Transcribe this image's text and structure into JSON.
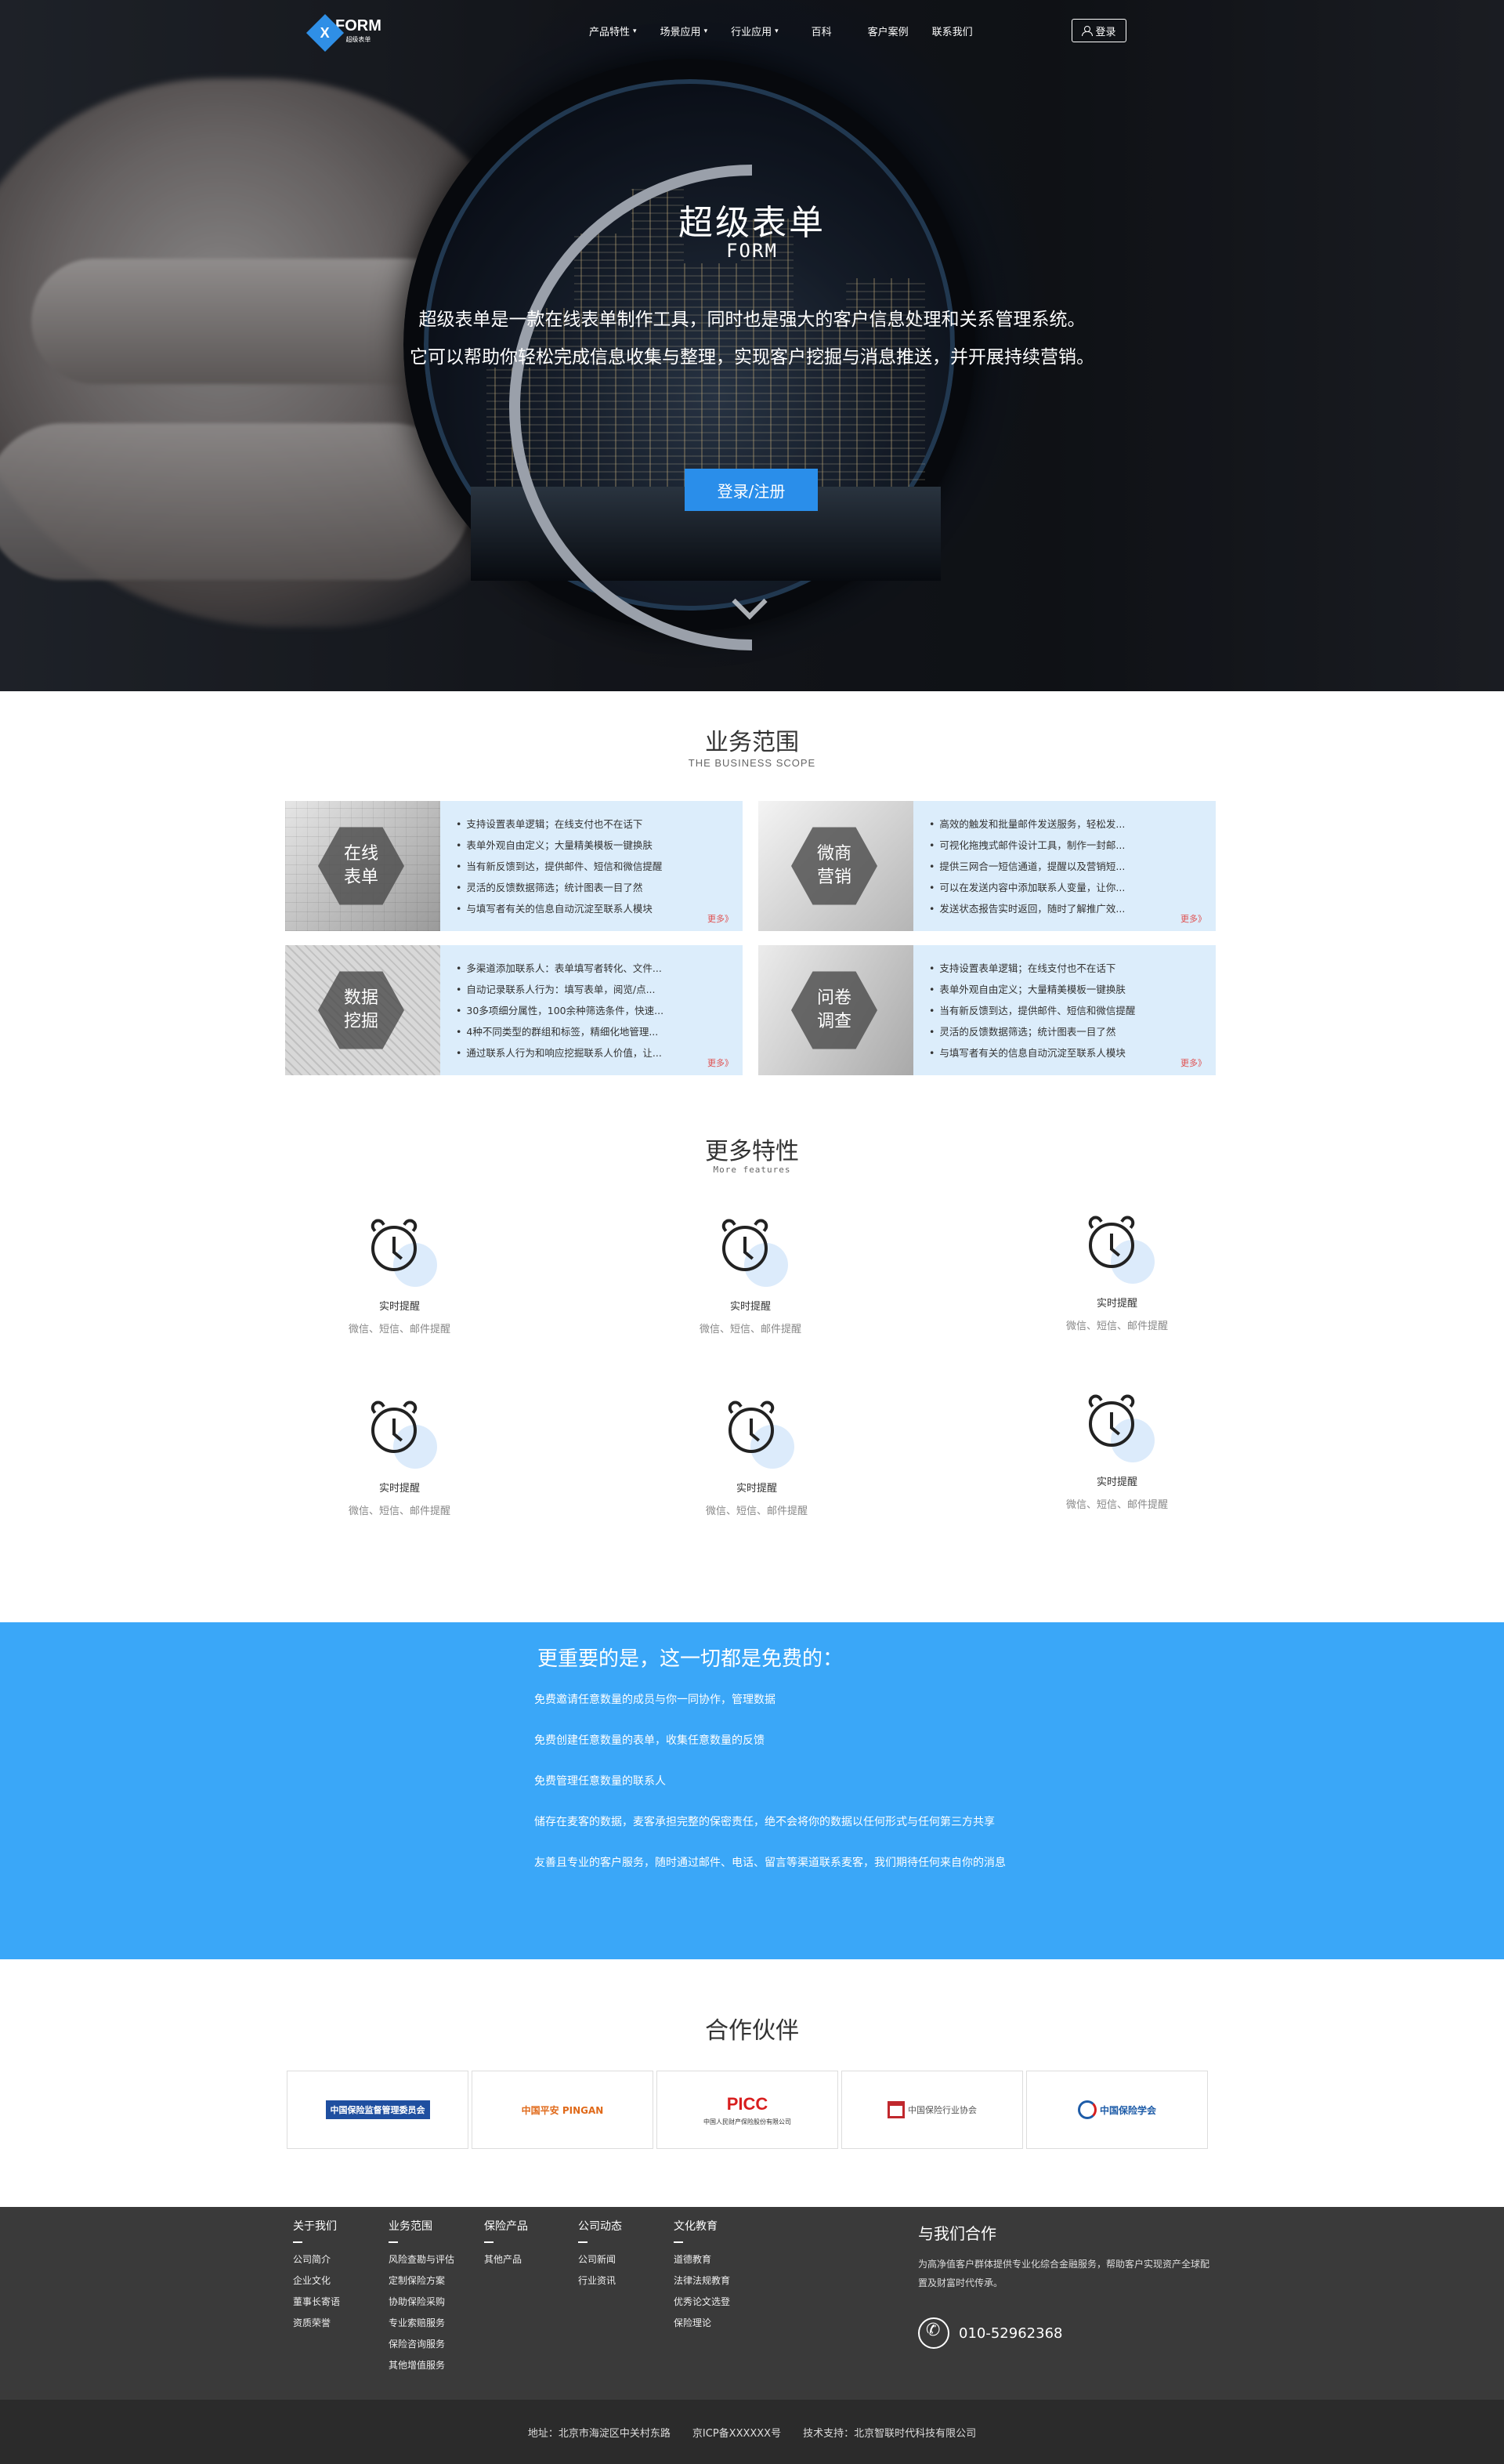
{
  "brand": {
    "logo_text": "FORM",
    "logo_sub": "超级表单",
    "logo_mark": "X"
  },
  "nav": {
    "items": [
      {
        "label": "产品特性",
        "dropdown": true
      },
      {
        "label": "场景应用",
        "dropdown": true
      },
      {
        "label": "行业应用",
        "dropdown": true
      },
      {
        "label": "百科",
        "dropdown": false
      },
      {
        "label": "客户案例",
        "dropdown": false
      },
      {
        "label": "联系我们",
        "dropdown": false
      }
    ],
    "login_label": "登录",
    "caret": "▾"
  },
  "hero": {
    "title": "超级表单",
    "subtitle": "FORM",
    "desc_line1": "超级表单是一款在线表单制作工具，同时也是强大的客户信息处理和关系管理系统。",
    "desc_line2": "它可以帮助你轻松完成信息收集与整理，实现客户挖掘与消息推送，并开展持续营销。",
    "button": "登录/注册"
  },
  "scope": {
    "title": "业务范围",
    "subtitle": "THE BUSINESS SCOPE",
    "more": "更多》",
    "cards": [
      {
        "hex_l1": "在线",
        "hex_l2": "表单",
        "items": [
          "支持设置表单逻辑；在线支付也不在话下",
          "表单外观自由定义；大量精美模板一键换肤",
          "当有新反馈到达，提供邮件、短信和微信提醒",
          "灵活的反馈数据筛选；统计图表一目了然",
          "与填写者有关的信息自动沉淀至联系人模块"
        ]
      },
      {
        "hex_l1": "微商",
        "hex_l2": "营销",
        "items": [
          "高效的触发和批量邮件发送服务，轻松发...",
          "可视化拖拽式邮件设计工具，制作一封邮...",
          "提供三网合一短信通道，提醒以及营销短...",
          "可以在发送内容中添加联系人变量，让你...",
          "发送状态报告实时返回，随时了解推广效..."
        ]
      },
      {
        "hex_l1": "数据",
        "hex_l2": "挖掘",
        "items": [
          "多渠道添加联系人：表单填写者转化、文件...",
          "自动记录联系人行为：填写表单，阅览/点...",
          "30多项细分属性，100余种筛选条件，快速...",
          "4种不同类型的群组和标签，精细化地管理...",
          "通过联系人行为和响应挖掘联系人价值，让..."
        ]
      },
      {
        "hex_l1": "问卷",
        "hex_l2": "调查",
        "items": [
          "支持设置表单逻辑；在线支付也不在话下",
          "表单外观自由定义；大量精美模板一键换肤",
          "当有新反馈到达，提供邮件、短信和微信提醒",
          "灵活的反馈数据筛选；统计图表一目了然",
          "与填写者有关的信息自动沉淀至联系人模块"
        ]
      }
    ]
  },
  "features": {
    "title": "更多特性",
    "subtitle": "More features",
    "items": [
      {
        "title": "实时提醒",
        "desc": "微信、短信、邮件提醒",
        "icon": "alarm-clock-icon"
      },
      {
        "title": "实时提醒",
        "desc": "微信、短信、邮件提醒",
        "icon": "alarm-clock-icon"
      },
      {
        "title": "实时提醒",
        "desc": "微信、短信、邮件提醒",
        "icon": "alarm-clock-icon"
      },
      {
        "title": "实时提醒",
        "desc": "微信、短信、邮件提醒",
        "icon": "alarm-clock-icon"
      },
      {
        "title": "实时提醒",
        "desc": "微信、短信、邮件提醒",
        "icon": "alarm-clock-icon"
      },
      {
        "title": "实时提醒",
        "desc": "微信、短信、邮件提醒",
        "icon": "alarm-clock-icon"
      }
    ]
  },
  "free": {
    "title": "更重要的是，这一切都是免费的：",
    "lines": [
      "免费邀请任意数量的成员与你一同协作，管理数据",
      "免费创建任意数量的表单，收集任意数量的反馈",
      "免费管理任意数量的联系人",
      "储存在麦客的数据，麦客承担完整的保密责任，绝不会将你的数据以任何形式与任何第三方共享",
      "友善且专业的客户服务，随时通过邮件、电话、留言等渠道联系麦客，我们期待任何来自你的消息"
    ],
    "bg_color": "#3aa7f8"
  },
  "partners": {
    "title": "合作伙伴",
    "items": [
      {
        "name": "中国保险监督管理委员会",
        "color": "#1f4fa0"
      },
      {
        "name": "中国平安 PINGAN",
        "color": "#e06a1a"
      },
      {
        "name": "PICC",
        "color": "#d81e1e",
        "sub": "中国人民财产保险股份有限公司"
      },
      {
        "name": "中国保险行业协会",
        "color": "#c0282d"
      },
      {
        "name": "中国保险学会",
        "color": "#1e5ca8"
      }
    ]
  },
  "footer": {
    "columns": [
      {
        "title": "关于我们",
        "links": [
          "公司简介",
          "企业文化",
          "董事长寄语",
          "资质荣誉"
        ]
      },
      {
        "title": "业务范围",
        "links": [
          "风险查勘与评估",
          "定制保险方案",
          "协助保险采购",
          "专业索赔服务",
          "保险咨询服务",
          "其他增值服务"
        ]
      },
      {
        "title": "保险产品",
        "links": [
          "其他产品"
        ]
      },
      {
        "title": "公司动态",
        "links": [
          "公司新闻",
          "行业资讯"
        ]
      },
      {
        "title": "文化教育",
        "links": [
          "道德教育",
          "法律法规教育",
          "优秀论文选登",
          "保险理论"
        ]
      }
    ],
    "coop_title": "与我们合作",
    "coop_desc": "为高净值客户群体提供专业化综合金融服务，帮助客户实现资产全球配置及财富时代传承。",
    "phone": "010-52962368",
    "address": "地址：北京市海淀区中关村东路",
    "icp": "京ICP备XXXXXX号",
    "support": "技术支持：北京智联时代科技有限公司"
  }
}
